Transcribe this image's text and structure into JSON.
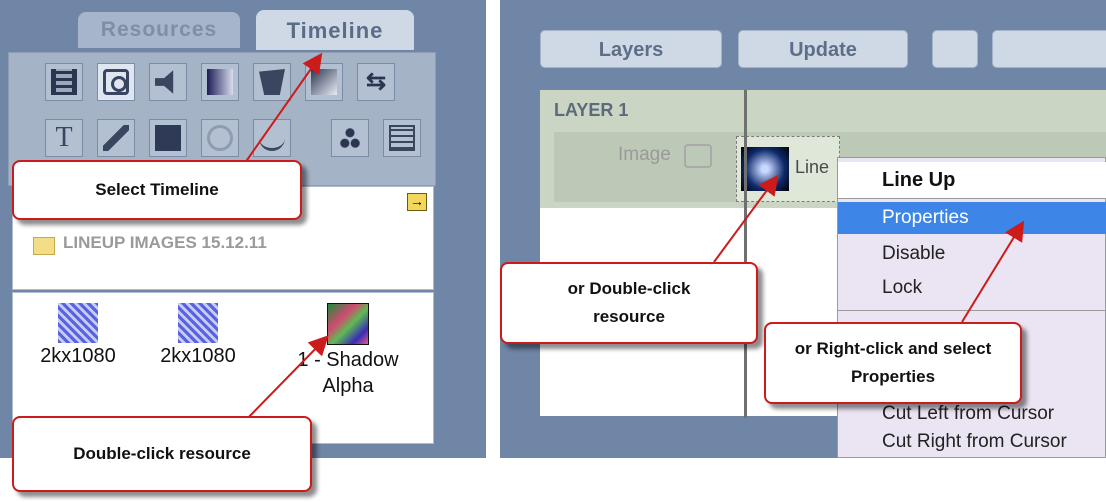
{
  "left_tabs": {
    "resources": "Resources",
    "timeline": "Timeline"
  },
  "tool_icons": [
    "film-icon",
    "camera-icon",
    "speaker-icon",
    "gradient-icon",
    "shape-icon",
    "rectangle-icon",
    "swap-icon",
    "text-icon",
    "pen-icon",
    "square-icon",
    "circle-icon",
    "wave-icon",
    "particles-icon",
    "list-icon"
  ],
  "folder": {
    "name": "LINEUP IMAGES 15.12.11"
  },
  "resources": [
    {
      "label": "2kx1080",
      "thumb": "blue-texture"
    },
    {
      "label": "2kx1080",
      "thumb": "blue-texture"
    },
    {
      "label": "1 - Shadow\nAlpha",
      "thumb": "color-texture"
    }
  ],
  "toolbar": {
    "layers": "Layers",
    "update": "Update"
  },
  "layer": {
    "title": "LAYER 1",
    "type_label": "Image",
    "clip_label": "Line"
  },
  "context_menu": {
    "header": "Line Up",
    "items": [
      {
        "label": "Properties",
        "selected": true
      },
      {
        "label": "Disable"
      },
      {
        "label": "Lock"
      },
      {
        "label": "Cut Left from Cursor"
      },
      {
        "label": "Cut Right from Cursor"
      }
    ]
  },
  "callouts": {
    "select_timeline": "Select Timeline",
    "double_click_clip": "or Double-click resource",
    "right_click": "or Right-click and select Properties",
    "double_click_resource": "Double-click resource"
  },
  "colors": {
    "accent_red": "#cc1b1b",
    "panel": "#6f86a6",
    "menu_selected": "#3d86e8"
  }
}
